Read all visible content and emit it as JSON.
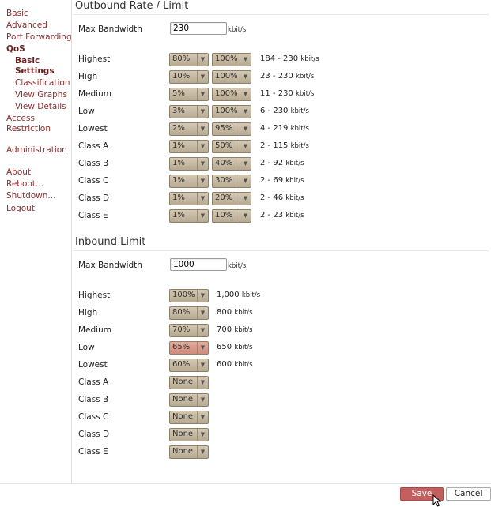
{
  "sidebar": {
    "items": [
      {
        "label": "Basic"
      },
      {
        "label": "Advanced"
      },
      {
        "label": "Port Forwarding"
      },
      {
        "label": "QoS"
      },
      {
        "label": "Basic"
      },
      {
        "label": "Settings"
      },
      {
        "label": "Classification"
      },
      {
        "label": "View Graphs"
      },
      {
        "label": "View Details"
      },
      {
        "label": "Access"
      },
      {
        "label": "Restriction"
      },
      {
        "label": "Administration"
      },
      {
        "label": "About"
      },
      {
        "label": "Reboot..."
      },
      {
        "label": "Shutdown..."
      },
      {
        "label": "Logout"
      }
    ]
  },
  "outbound": {
    "title": "Outbound Rate / Limit",
    "max_bw_label": "Max Bandwidth",
    "max_bw_value": "230",
    "unit": "kbit/s",
    "rows": [
      {
        "label": "Highest",
        "rate": "80%",
        "limit": "100%",
        "range": "184 - 230",
        "unit": "kbit/s"
      },
      {
        "label": "High",
        "rate": "10%",
        "limit": "100%",
        "range": "23 - 230",
        "unit": "kbit/s"
      },
      {
        "label": "Medium",
        "rate": "5%",
        "limit": "100%",
        "range": "11 - 230",
        "unit": "kbit/s"
      },
      {
        "label": "Low",
        "rate": "3%",
        "limit": "100%",
        "range": "6 - 230",
        "unit": "kbit/s"
      },
      {
        "label": "Lowest",
        "rate": "2%",
        "limit": "95%",
        "range": "4 - 219",
        "unit": "kbit/s"
      },
      {
        "label": "Class A",
        "rate": "1%",
        "limit": "50%",
        "range": "2 - 115",
        "unit": "kbit/s"
      },
      {
        "label": "Class B",
        "rate": "1%",
        "limit": "40%",
        "range": "2 - 92",
        "unit": "kbit/s"
      },
      {
        "label": "Class C",
        "rate": "1%",
        "limit": "30%",
        "range": "2 - 69",
        "unit": "kbit/s"
      },
      {
        "label": "Class D",
        "rate": "1%",
        "limit": "20%",
        "range": "2 - 46",
        "unit": "kbit/s"
      },
      {
        "label": "Class E",
        "rate": "1%",
        "limit": "10%",
        "range": "2 - 23",
        "unit": "kbit/s"
      }
    ]
  },
  "inbound": {
    "title": "Inbound Limit",
    "max_bw_label": "Max Bandwidth",
    "max_bw_value": "1000",
    "unit": "kbit/s",
    "rows": [
      {
        "label": "Highest",
        "limit": "100%",
        "range": "1,000",
        "unit": "kbit/s"
      },
      {
        "label": "High",
        "limit": "80%",
        "range": "800",
        "unit": "kbit/s"
      },
      {
        "label": "Medium",
        "limit": "70%",
        "range": "700",
        "unit": "kbit/s"
      },
      {
        "label": "Low",
        "limit": "65%",
        "range": "650",
        "unit": "kbit/s",
        "highlight": true
      },
      {
        "label": "Lowest",
        "limit": "60%",
        "range": "600",
        "unit": "kbit/s"
      },
      {
        "label": "Class A",
        "limit": "None"
      },
      {
        "label": "Class B",
        "limit": "None"
      },
      {
        "label": "Class C",
        "limit": "None"
      },
      {
        "label": "Class D",
        "limit": "None"
      },
      {
        "label": "Class E",
        "limit": "None"
      }
    ]
  },
  "footer": {
    "save_label": "Save",
    "cancel_label": "Cancel"
  },
  "colors": {
    "accent_save": "#c26060",
    "nav_link": "#8b3030",
    "select_bg": "#c6b9a2",
    "select_highlight": "#d89a8b"
  },
  "icons": {
    "dropdown": "chevron-down-icon",
    "cursor": "mouse-pointer-icon"
  }
}
